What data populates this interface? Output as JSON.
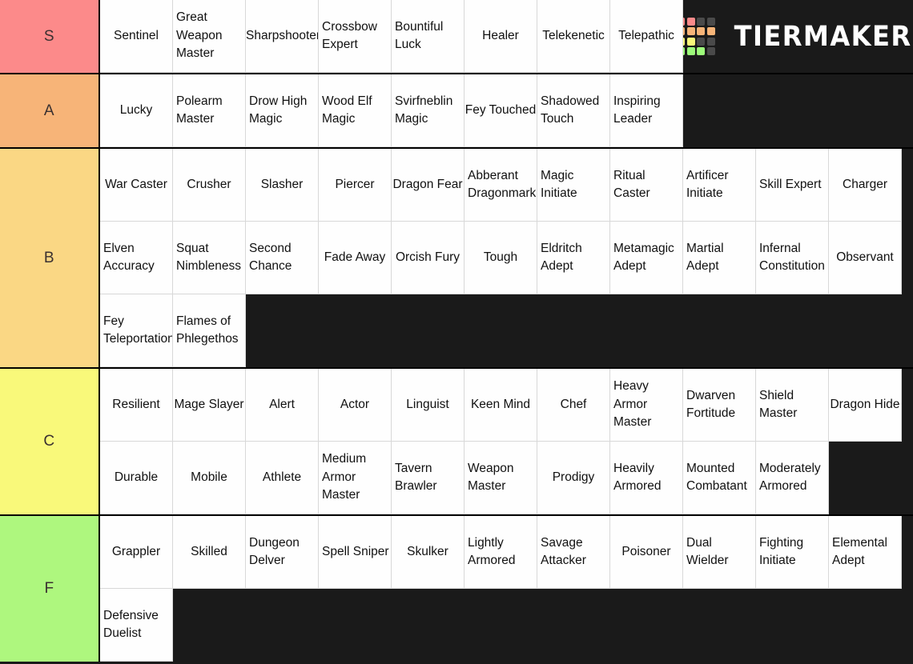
{
  "app": {
    "name": "TierMaker",
    "logo_word": "TIERMAKER",
    "logo_colors": [
      "#fc8a8a",
      "#fc8a8a",
      "#4a4a4a",
      "#4a4a4a",
      "#f7b478",
      "#f7b478",
      "#f7b478",
      "#f7b478",
      "#f9f97a",
      "#f9f97a",
      "#4a4a4a",
      "#4a4a4a",
      "#9dfc7a",
      "#9dfc7a",
      "#9dfc7a",
      "#4a4a4a"
    ],
    "background": "#1a1a1a"
  },
  "tiers": [
    {
      "label": "S",
      "color": "#fc8a8a",
      "rows": [
        [
          "Sentinel",
          "Great Weapon Master",
          "Sharpshooter",
          "Crossbow Expert",
          "Bountiful Luck",
          "Healer",
          "Telekenetic",
          "Telepathic"
        ]
      ]
    },
    {
      "label": "A",
      "color": "#f7b478",
      "rows": [
        [
          "Lucky",
          "Polearm Master",
          "Drow High Magic",
          "Wood Elf Magic",
          "Svirfneblin Magic",
          "Fey Touched",
          "Shadowed Touch",
          "Inspiring Leader"
        ]
      ]
    },
    {
      "label": "B",
      "color": "#fad784",
      "rows": [
        [
          "War Caster",
          "Crusher",
          "Slasher",
          "Piercer",
          "Dragon Fear",
          "Abberant Dragonmark",
          "Magic Initiate",
          "Ritual Caster",
          "Artificer Initiate",
          "Skill Expert",
          "Charger"
        ],
        [
          "Elven Accuracy",
          "Squat Nimbleness",
          "Second Chance",
          "Fade Away",
          "Orcish Fury",
          "Tough",
          "Eldritch Adept",
          "Metamagic Adept",
          "Martial Adept",
          "Infernal Constitution",
          "Observant"
        ],
        [
          "Fey Teleportation",
          "Flames of Phlegethos"
        ]
      ]
    },
    {
      "label": "C",
      "color": "#f9f97a",
      "rows": [
        [
          "Resilient",
          "Mage Slayer",
          "Alert",
          "Actor",
          "Linguist",
          "Keen Mind",
          "Chef",
          "Heavy Armor Master",
          "Dwarven Fortitude",
          "Shield Master",
          "Dragon Hide"
        ],
        [
          "Durable",
          "Mobile",
          "Athlete",
          "Medium Armor Master",
          "Tavern Brawler",
          "Weapon Master",
          "Prodigy",
          "Heavily Armored",
          "Mounted Combatant",
          "Moderately Armored"
        ]
      ]
    },
    {
      "label": "F",
      "color": "#aef77e",
      "rows": [
        [
          "Grappler",
          "Skilled",
          "Dungeon Delver",
          "Spell Sniper",
          "Skulker",
          "Lightly Armored",
          "Savage Attacker",
          "Poisoner",
          "Dual Wielder",
          "Fighting Initiate",
          "Elemental Adept"
        ],
        [
          "Defensive Duelist"
        ]
      ]
    }
  ]
}
